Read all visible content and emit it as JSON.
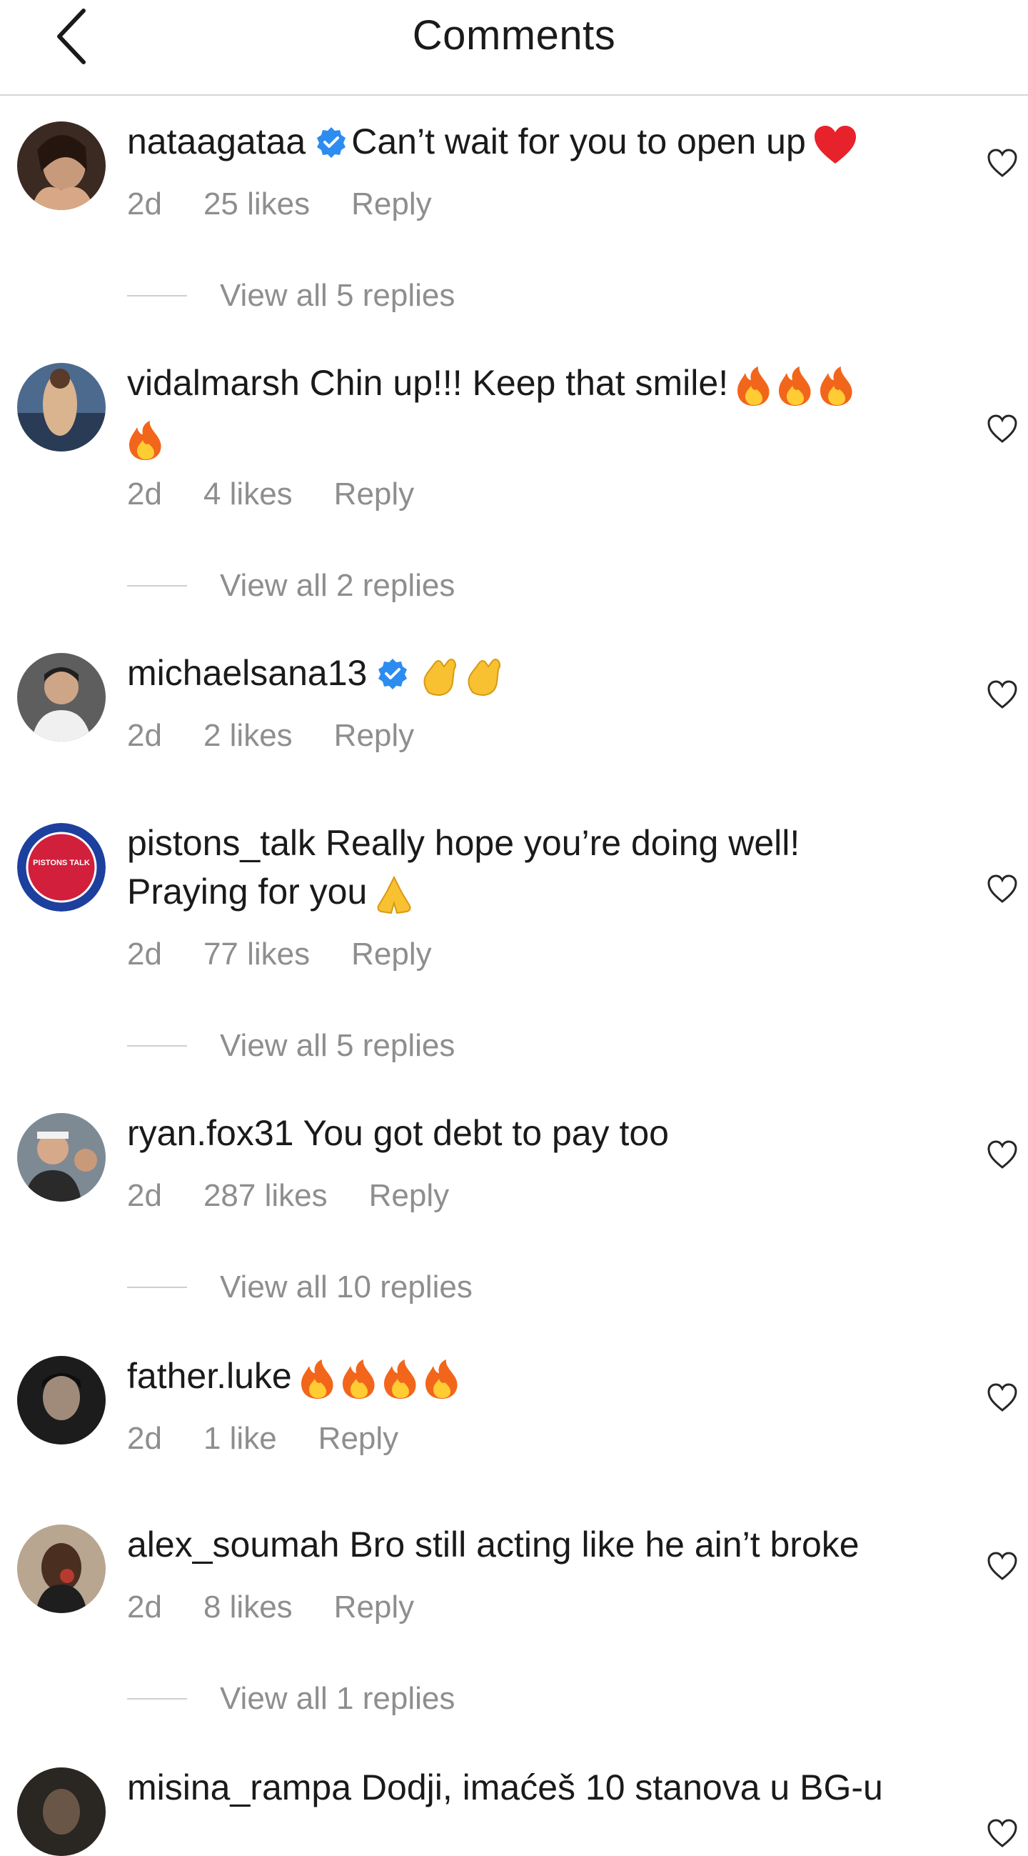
{
  "header": {
    "title": "Comments",
    "back_icon": "chevron-left-icon"
  },
  "colors": {
    "verified": "#2d8cf0",
    "meta": "#8e8e8e",
    "divider": "#d6d6d6"
  },
  "comments": [
    {
      "username": "nataagataa",
      "verified": true,
      "text": "Can’t wait for you to open up",
      "emojis": [
        "red-heart"
      ],
      "time": "2d",
      "likes": "25 likes",
      "reply": "Reply",
      "view_replies": "View all 5 replies"
    },
    {
      "username": "vidalmarsh",
      "verified": false,
      "text": "Chin up!!! Keep that smile!",
      "emojis": [
        "fire",
        "fire",
        "fire",
        "fire"
      ],
      "time": "2d",
      "likes": "4 likes",
      "reply": "Reply",
      "view_replies": "View all 2 replies"
    },
    {
      "username": "michaelsana13",
      "verified": true,
      "text": "",
      "emojis": [
        "clapping-hands",
        "clapping-hands"
      ],
      "time": "2d",
      "likes": "2 likes",
      "reply": "Reply",
      "view_replies": ""
    },
    {
      "username": "pistons_talk",
      "verified": false,
      "text": "Really hope you’re doing well!",
      "text2": "Praying for you",
      "emojis": [
        "folded-hands"
      ],
      "avatar_text": "PISTONS TALK",
      "time": "2d",
      "likes": "77 likes",
      "reply": "Reply",
      "view_replies": "View all 5 replies"
    },
    {
      "username": "ryan.fox31",
      "verified": false,
      "text": "You got debt to pay too",
      "emojis": [],
      "time": "2d",
      "likes": "287 likes",
      "reply": "Reply",
      "view_replies": "View all 10 replies"
    },
    {
      "username": "father.luke",
      "verified": false,
      "text": "",
      "emojis": [
        "fire",
        "fire",
        "fire",
        "fire"
      ],
      "time": "2d",
      "likes": "1 like",
      "reply": "Reply",
      "view_replies": ""
    },
    {
      "username": "alex_soumah",
      "verified": false,
      "text": "Bro still acting like he ain’t broke",
      "emojis": [],
      "time": "2d",
      "likes": "8 likes",
      "reply": "Reply",
      "view_replies": "View all 1 replies"
    },
    {
      "username": "misina_rampa",
      "verified": false,
      "text": "Dodji, imaćeš 10 stanova u BG-u",
      "emojis": [],
      "time": "",
      "likes": "",
      "reply": "",
      "view_replies": ""
    }
  ]
}
